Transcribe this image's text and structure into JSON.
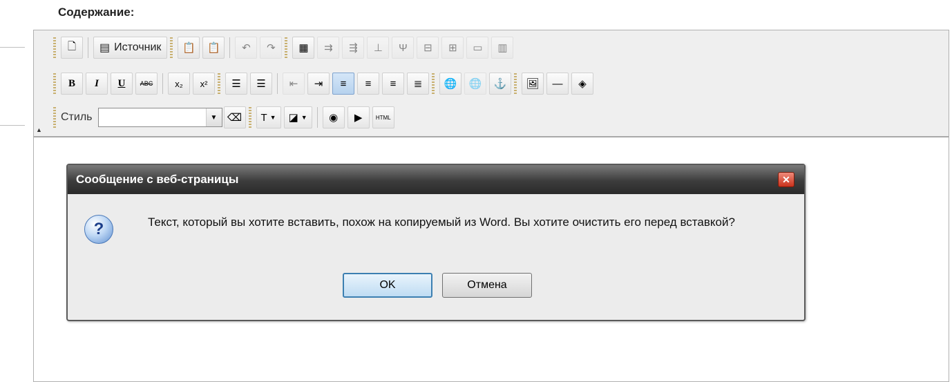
{
  "page": {
    "heading": "Содержание:"
  },
  "toolbar": {
    "source_label": "Источник",
    "style_label": "Стиль",
    "style_value": "",
    "bold": "B",
    "italic": "I",
    "underline": "U",
    "strike": "ABC",
    "subscript": "x₂",
    "superscript": "x²",
    "html_badge": "HTML"
  },
  "dialog": {
    "title": "Сообщение с веб-страницы",
    "message": "Текст, который вы хотите вставить, похож на копируемый из Word. Вы хотите очистить его перед вставкой?",
    "ok": "OK",
    "cancel": "Отмена",
    "close_glyph": "✕",
    "icon_glyph": "?"
  }
}
